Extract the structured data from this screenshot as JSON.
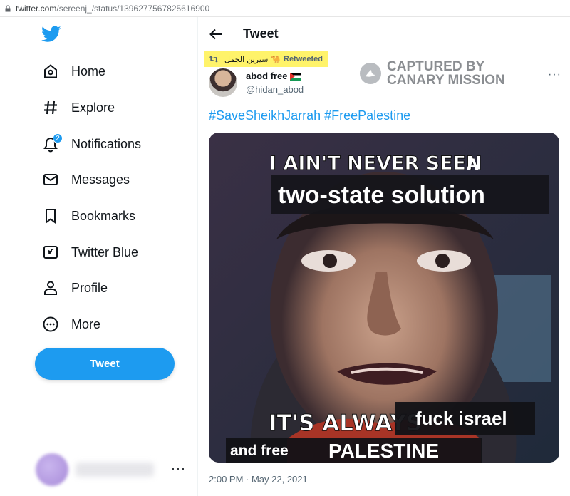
{
  "browser": {
    "url_host": "twitter.com",
    "url_path": "/sereenj_/status/1396277567825616900"
  },
  "sidebar": {
    "logo": "twitter-bird-icon",
    "items": [
      {
        "label": "Home",
        "icon": "home-icon"
      },
      {
        "label": "Explore",
        "icon": "hashtag-icon"
      },
      {
        "label": "Notifications",
        "icon": "bell-icon",
        "badge": "2"
      },
      {
        "label": "Messages",
        "icon": "envelope-icon"
      },
      {
        "label": "Bookmarks",
        "icon": "bookmark-icon"
      },
      {
        "label": "Twitter Blue",
        "icon": "twitter-blue-icon"
      },
      {
        "label": "Profile",
        "icon": "person-icon"
      },
      {
        "label": "More",
        "icon": "more-circle-icon"
      }
    ],
    "tweet_button": "Tweet",
    "account_more": "···"
  },
  "header": {
    "title": "Tweet"
  },
  "tweet": {
    "retweeted_by": "سيرين الجمل",
    "retweeted_emoji": "🐪",
    "retweeted_label": "Retweeted",
    "author_name": "abod free",
    "author_handle": "@hidan_abod",
    "more": "···",
    "hashtags": [
      "#SaveSheikhJarrah",
      "#FreePalestine"
    ],
    "image_text": {
      "line1": "I AIN'T NEVER SEEN",
      "line1_small": "A",
      "line2": "two-state solution",
      "line3": "IT'S ALWAYS",
      "line3_box": "fuck israel",
      "line4a": "and free",
      "line4b": "PALESTINE"
    },
    "timestamp": "2:00 PM · May 22, 2021"
  },
  "watermark": {
    "line1": "CAPTURED BY",
    "line2": "CANARY MISSION"
  },
  "colors": {
    "accent": "#1d9bf0",
    "highlight": "#fff36a",
    "text": "#0f1419",
    "muted": "#536471"
  }
}
